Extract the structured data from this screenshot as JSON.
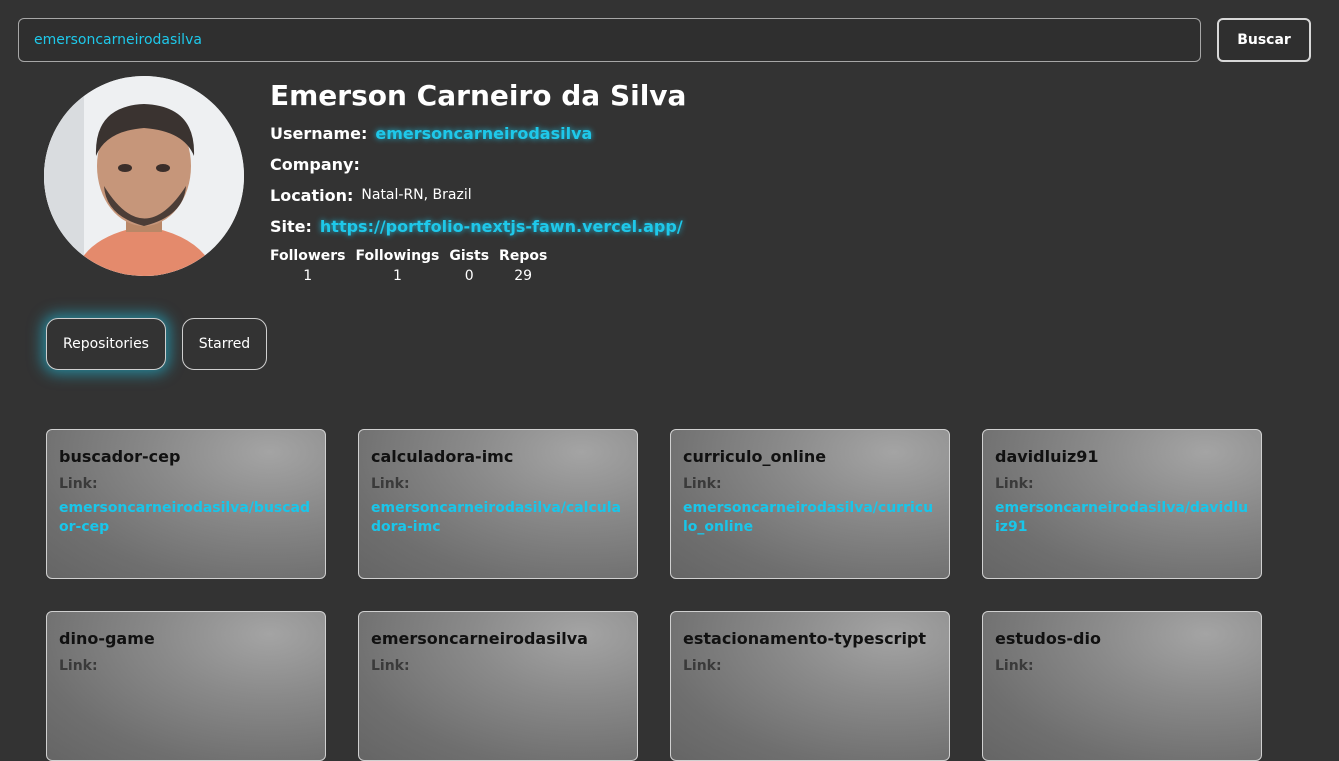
{
  "search": {
    "value": "emersoncarneirodasilva",
    "button_label": "Buscar"
  },
  "profile": {
    "name": "Emerson Carneiro da Silva",
    "username_label": "Username:",
    "username": "emersoncarneirodasilva",
    "company_label": "Company:",
    "company": "",
    "location_label": "Location:",
    "location": "Natal-RN, Brazil",
    "site_label": "Site:",
    "site": "https://portfolio-nextjs-fawn.vercel.app/",
    "stats": [
      {
        "label": "Followers",
        "value": "1"
      },
      {
        "label": "Followings",
        "value": "1"
      },
      {
        "label": "Gists",
        "value": "0"
      },
      {
        "label": "Repos",
        "value": "29"
      }
    ]
  },
  "tabs": [
    {
      "label": "Repositories",
      "active": true
    },
    {
      "label": "Starred",
      "active": false
    }
  ],
  "repos": [
    {
      "name": "buscador-cep",
      "link_label": "Link:",
      "link": "emersoncarneirodasilva/buscador-cep"
    },
    {
      "name": "calculadora-imc",
      "link_label": "Link:",
      "link": "emersoncarneirodasilva/calculadora-imc"
    },
    {
      "name": "curriculo_online",
      "link_label": "Link:",
      "link": "emersoncarneirodasilva/curriculo_online"
    },
    {
      "name": "davidluiz91",
      "link_label": "Link:",
      "link": "emersoncarneirodasilva/davidluiz91"
    },
    {
      "name": "dino-game",
      "link_label": "Link:",
      "link": ""
    },
    {
      "name": "emersoncarneirodasilva",
      "link_label": "Link:",
      "link": ""
    },
    {
      "name": "estacionamento-typescript",
      "link_label": "Link:",
      "link": ""
    },
    {
      "name": "estudos-dio",
      "link_label": "Link:",
      "link": ""
    }
  ],
  "colors": {
    "background": "#333333",
    "accent": "#1ec8ea"
  }
}
